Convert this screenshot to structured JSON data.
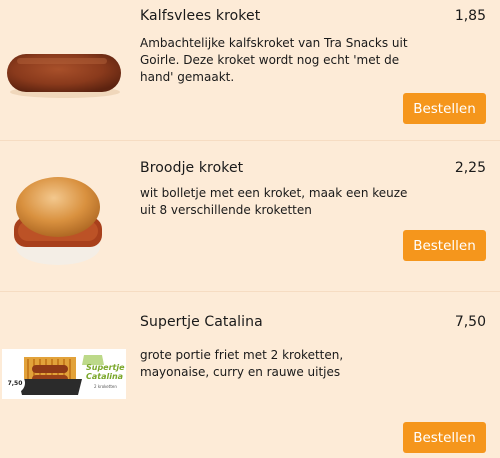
{
  "products": [
    {
      "title": "Kalfsvlees kroket",
      "price": "1,85",
      "description": "Ambachtelijke kalfskroket van Tra Snacks uit Goirle. Deze kroket wordt nog echt 'met de hand' gemaakt.",
      "button_label": "Bestellen",
      "image": "kroket-image"
    },
    {
      "title": "Broodje kroket",
      "price": "2,25",
      "description": "wit bolletje met een kroket, maak een keuze uit 8 verschillende kroketten",
      "button_label": "Bestellen",
      "image": "broodje-kroket-image"
    },
    {
      "title": "Supertje Catalina",
      "price": "7,50",
      "description": "grote portie friet met 2 kroketten, mayonaise, curry en rauwe uitjes",
      "button_label": "Bestellen",
      "image": "supertje-catalina-image",
      "image_text": {
        "price_badge": "7,50",
        "name_line1": "Supertje",
        "name_line2": "Catalina",
        "subtitle": "2 kroketten"
      }
    }
  ],
  "colors": {
    "background": "#fdebd7",
    "button": "#f5961c",
    "button_text": "#ffffff"
  }
}
